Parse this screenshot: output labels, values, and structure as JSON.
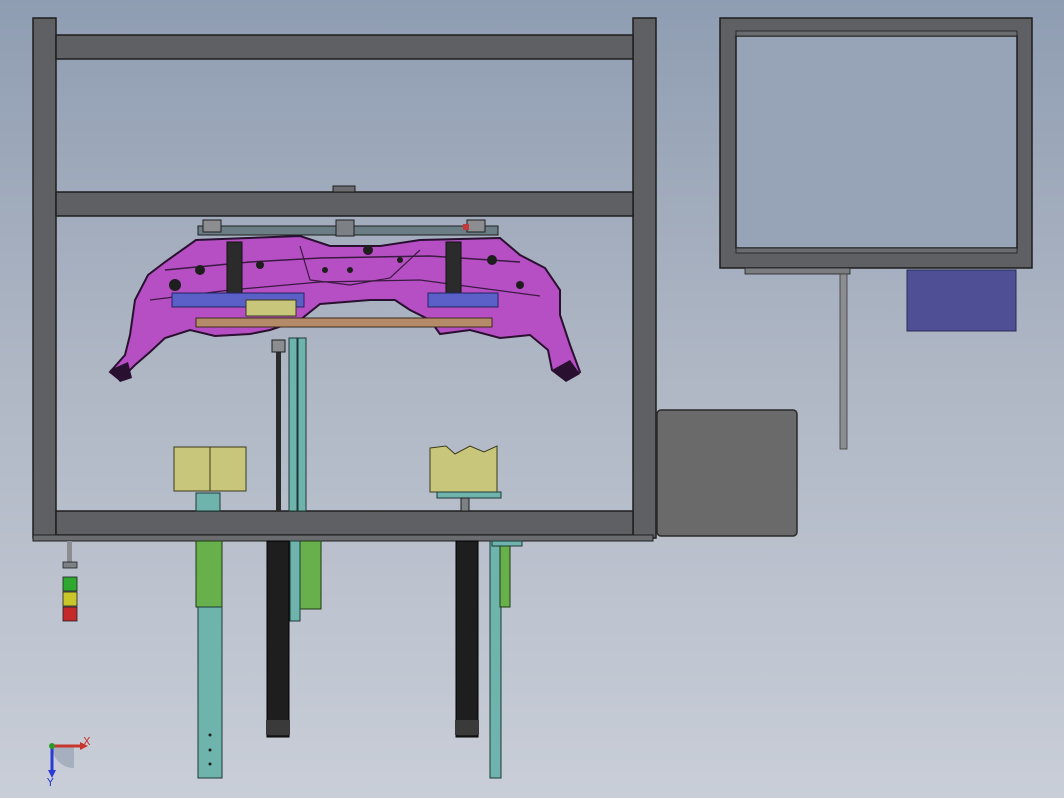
{
  "viewport": {
    "background_top": "#8f9db2",
    "background_bottom": "#c9ced8"
  },
  "colors": {
    "frame": "#5f6063",
    "frame_edge": "#2a2a2a",
    "part": "#b64fc4",
    "clamp_blue": "#5b5fc8",
    "locator_yellow": "#c8c67a",
    "cylinder_green": "#67b04b",
    "slide_teal": "#6fb3ad",
    "cylinder_black": "#1e1e1e",
    "control_box": "#6a6a6b",
    "blue_block": "#4f4f96",
    "copper_bar": "#b58a68"
  },
  "triad": {
    "x_label": "X",
    "y_label": "Y",
    "icon": "coordinate-triad-icon"
  },
  "stack_light": {
    "icon": "stack-light-icon",
    "segments": [
      "green",
      "yellow",
      "red"
    ]
  }
}
